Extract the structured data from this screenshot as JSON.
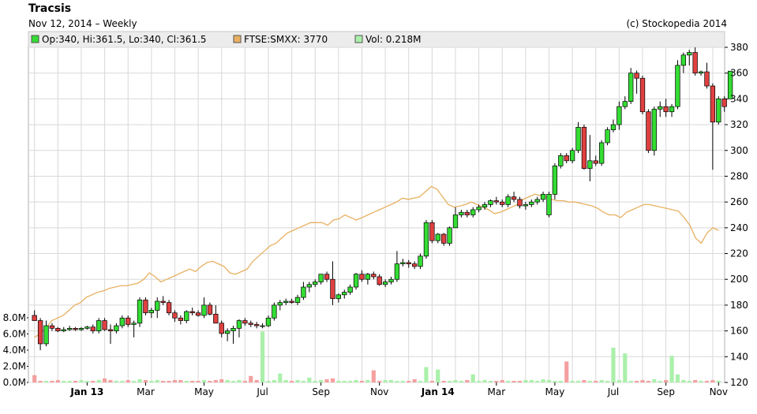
{
  "header": {
    "title": "Tracsis",
    "subtitle": "Nov 12, 2014 – Weekly",
    "copyright": "(c) Stockopedia 2014"
  },
  "legend": {
    "ohlc": "Op:340, Hi:361.5, Lo:340, Cl:361.5",
    "index": "FTSE:SMXX: 3770",
    "volume": "Vol: 0.218M"
  },
  "colors": {
    "up": "#33dd33",
    "down": "#e04040",
    "index_line": "#e8b060",
    "vol_up": "#aaf0aa",
    "vol_down": "#f4a0a0",
    "grid": "#d8d8d8",
    "legend_bg": "#ececec"
  },
  "chart_data": {
    "type": "candlestick",
    "price_axis": {
      "min": 120,
      "max": 380,
      "ticks": [
        120,
        140,
        160,
        180,
        200,
        220,
        240,
        260,
        280,
        300,
        320,
        340,
        360,
        380
      ]
    },
    "volume_axis": {
      "unit": "M",
      "min": 0,
      "max": 8,
      "ticks": [
        "0.0M",
        "2.0M",
        "4.0M",
        "6.0M",
        "8.0M"
      ],
      "tick_values": [
        0,
        2,
        4,
        6,
        8
      ]
    },
    "x_labels": [
      "Jan 13",
      "Mar",
      "May",
      "Jul",
      "Sep",
      "Nov",
      "Jan 14",
      "Mar",
      "May",
      "Jul",
      "Sep",
      "Nov"
    ],
    "x_label_weeks": [
      9,
      19,
      29,
      39,
      49,
      59,
      69,
      79,
      89,
      99,
      108,
      117
    ],
    "bold_labels": [
      "Jan 13",
      "Jan 14"
    ],
    "weeks": 118,
    "candles": [
      {
        "o": 172,
        "h": 176,
        "l": 168,
        "c": 168
      },
      {
        "o": 168,
        "h": 170,
        "l": 145,
        "c": 150
      },
      {
        "o": 150,
        "h": 168,
        "l": 148,
        "c": 164
      },
      {
        "o": 164,
        "h": 166,
        "l": 160,
        "c": 162
      },
      {
        "o": 162,
        "h": 163,
        "l": 159,
        "c": 160
      },
      {
        "o": 160,
        "h": 163,
        "l": 159,
        "c": 161
      },
      {
        "o": 161,
        "h": 164,
        "l": 160,
        "c": 162
      },
      {
        "o": 162,
        "h": 163,
        "l": 160,
        "c": 161
      },
      {
        "o": 161,
        "h": 163,
        "l": 160,
        "c": 162
      },
      {
        "o": 162,
        "h": 164,
        "l": 161,
        "c": 163
      },
      {
        "o": 163,
        "h": 165,
        "l": 158,
        "c": 160
      },
      {
        "o": 160,
        "h": 170,
        "l": 158,
        "c": 168
      },
      {
        "o": 168,
        "h": 170,
        "l": 160,
        "c": 161
      },
      {
        "o": 161,
        "h": 165,
        "l": 150,
        "c": 160
      },
      {
        "o": 160,
        "h": 166,
        "l": 158,
        "c": 164
      },
      {
        "o": 164,
        "h": 172,
        "l": 162,
        "c": 170
      },
      {
        "o": 170,
        "h": 172,
        "l": 163,
        "c": 165
      },
      {
        "o": 165,
        "h": 168,
        "l": 155,
        "c": 166
      },
      {
        "o": 166,
        "h": 186,
        "l": 163,
        "c": 184
      },
      {
        "o": 184,
        "h": 186,
        "l": 172,
        "c": 174
      },
      {
        "o": 174,
        "h": 178,
        "l": 170,
        "c": 176
      },
      {
        "o": 176,
        "h": 186,
        "l": 170,
        "c": 183
      },
      {
        "o": 183,
        "h": 187,
        "l": 180,
        "c": 182
      },
      {
        "o": 182,
        "h": 184,
        "l": 172,
        "c": 174
      },
      {
        "o": 174,
        "h": 176,
        "l": 167,
        "c": 170
      },
      {
        "o": 170,
        "h": 172,
        "l": 165,
        "c": 168
      },
      {
        "o": 168,
        "h": 176,
        "l": 166,
        "c": 175
      },
      {
        "o": 175,
        "h": 178,
        "l": 172,
        "c": 174
      },
      {
        "o": 174,
        "h": 176,
        "l": 171,
        "c": 172
      },
      {
        "o": 172,
        "h": 186,
        "l": 170,
        "c": 180
      },
      {
        "o": 180,
        "h": 182,
        "l": 172,
        "c": 173
      },
      {
        "o": 173,
        "h": 180,
        "l": 166,
        "c": 166
      },
      {
        "o": 166,
        "h": 168,
        "l": 155,
        "c": 158
      },
      {
        "o": 158,
        "h": 162,
        "l": 152,
        "c": 160
      },
      {
        "o": 160,
        "h": 164,
        "l": 150,
        "c": 162
      },
      {
        "o": 162,
        "h": 169,
        "l": 155,
        "c": 168
      },
      {
        "o": 168,
        "h": 170,
        "l": 164,
        "c": 166
      },
      {
        "o": 166,
        "h": 168,
        "l": 163,
        "c": 165
      },
      {
        "o": 165,
        "h": 167,
        "l": 162,
        "c": 164
      },
      {
        "o": 164,
        "h": 166,
        "l": 162,
        "c": 164
      },
      {
        "o": 164,
        "h": 172,
        "l": 163,
        "c": 170
      },
      {
        "o": 170,
        "h": 182,
        "l": 168,
        "c": 180
      },
      {
        "o": 180,
        "h": 184,
        "l": 176,
        "c": 182
      },
      {
        "o": 182,
        "h": 185,
        "l": 180,
        "c": 183
      },
      {
        "o": 183,
        "h": 185,
        "l": 181,
        "c": 182
      },
      {
        "o": 182,
        "h": 188,
        "l": 180,
        "c": 186
      },
      {
        "o": 186,
        "h": 198,
        "l": 184,
        "c": 194
      },
      {
        "o": 194,
        "h": 198,
        "l": 190,
        "c": 196
      },
      {
        "o": 196,
        "h": 200,
        "l": 194,
        "c": 198
      },
      {
        "o": 198,
        "h": 204,
        "l": 196,
        "c": 204
      },
      {
        "o": 204,
        "h": 206,
        "l": 198,
        "c": 200
      },
      {
        "o": 200,
        "h": 214,
        "l": 180,
        "c": 185
      },
      {
        "o": 185,
        "h": 189,
        "l": 182,
        "c": 188
      },
      {
        "o": 188,
        "h": 192,
        "l": 185,
        "c": 190
      },
      {
        "o": 190,
        "h": 196,
        "l": 188,
        "c": 194
      },
      {
        "o": 194,
        "h": 205,
        "l": 192,
        "c": 204
      },
      {
        "o": 204,
        "h": 207,
        "l": 198,
        "c": 200
      },
      {
        "o": 200,
        "h": 205,
        "l": 196,
        "c": 204
      },
      {
        "o": 204,
        "h": 206,
        "l": 200,
        "c": 202
      },
      {
        "o": 202,
        "h": 204,
        "l": 195,
        "c": 196
      },
      {
        "o": 196,
        "h": 200,
        "l": 194,
        "c": 198
      },
      {
        "o": 198,
        "h": 202,
        "l": 196,
        "c": 200
      },
      {
        "o": 200,
        "h": 222,
        "l": 198,
        "c": 212
      },
      {
        "o": 212,
        "h": 216,
        "l": 210,
        "c": 213
      },
      {
        "o": 213,
        "h": 215,
        "l": 209,
        "c": 212
      },
      {
        "o": 212,
        "h": 214,
        "l": 208,
        "c": 210
      },
      {
        "o": 210,
        "h": 220,
        "l": 208,
        "c": 218
      },
      {
        "o": 218,
        "h": 246,
        "l": 216,
        "c": 244
      },
      {
        "o": 244,
        "h": 246,
        "l": 228,
        "c": 230
      },
      {
        "o": 230,
        "h": 236,
        "l": 228,
        "c": 235
      },
      {
        "o": 235,
        "h": 236,
        "l": 226,
        "c": 228
      },
      {
        "o": 228,
        "h": 241,
        "l": 226,
        "c": 240
      },
      {
        "o": 240,
        "h": 256,
        "l": 240,
        "c": 250
      },
      {
        "o": 250,
        "h": 254,
        "l": 248,
        "c": 252
      },
      {
        "o": 252,
        "h": 254,
        "l": 248,
        "c": 250
      },
      {
        "o": 250,
        "h": 256,
        "l": 248,
        "c": 254
      },
      {
        "o": 254,
        "h": 258,
        "l": 252,
        "c": 256
      },
      {
        "o": 256,
        "h": 260,
        "l": 254,
        "c": 258
      },
      {
        "o": 258,
        "h": 262,
        "l": 256,
        "c": 261
      },
      {
        "o": 261,
        "h": 264,
        "l": 258,
        "c": 260
      },
      {
        "o": 260,
        "h": 262,
        "l": 256,
        "c": 258
      },
      {
        "o": 258,
        "h": 266,
        "l": 256,
        "c": 264
      },
      {
        "o": 264,
        "h": 268,
        "l": 260,
        "c": 262
      },
      {
        "o": 262,
        "h": 264,
        "l": 255,
        "c": 257
      },
      {
        "o": 257,
        "h": 260,
        "l": 254,
        "c": 258
      },
      {
        "o": 258,
        "h": 262,
        "l": 256,
        "c": 260
      },
      {
        "o": 260,
        "h": 264,
        "l": 258,
        "c": 262
      },
      {
        "o": 262,
        "h": 268,
        "l": 260,
        "c": 266
      },
      {
        "o": 250,
        "h": 268,
        "l": 248,
        "c": 266
      },
      {
        "o": 266,
        "h": 290,
        "l": 262,
        "c": 288
      },
      {
        "o": 288,
        "h": 298,
        "l": 286,
        "c": 296
      },
      {
        "o": 296,
        "h": 298,
        "l": 290,
        "c": 292
      },
      {
        "o": 292,
        "h": 302,
        "l": 290,
        "c": 300
      },
      {
        "o": 300,
        "h": 322,
        "l": 298,
        "c": 318
      },
      {
        "o": 318,
        "h": 320,
        "l": 285,
        "c": 286
      },
      {
        "o": 286,
        "h": 312,
        "l": 276,
        "c": 292
      },
      {
        "o": 292,
        "h": 296,
        "l": 288,
        "c": 290
      },
      {
        "o": 290,
        "h": 308,
        "l": 288,
        "c": 306
      },
      {
        "o": 306,
        "h": 318,
        "l": 304,
        "c": 316
      },
      {
        "o": 316,
        "h": 324,
        "l": 314,
        "c": 320
      },
      {
        "o": 320,
        "h": 338,
        "l": 316,
        "c": 334
      },
      {
        "o": 334,
        "h": 342,
        "l": 332,
        "c": 338
      },
      {
        "o": 338,
        "h": 364,
        "l": 336,
        "c": 360
      },
      {
        "o": 360,
        "h": 362,
        "l": 344,
        "c": 356
      },
      {
        "o": 356,
        "h": 358,
        "l": 328,
        "c": 330
      },
      {
        "o": 330,
        "h": 332,
        "l": 298,
        "c": 300
      },
      {
        "o": 300,
        "h": 334,
        "l": 296,
        "c": 332
      },
      {
        "o": 332,
        "h": 338,
        "l": 326,
        "c": 334
      },
      {
        "o": 334,
        "h": 340,
        "l": 326,
        "c": 330
      },
      {
        "o": 330,
        "h": 336,
        "l": 326,
        "c": 334
      },
      {
        "o": 334,
        "h": 370,
        "l": 332,
        "c": 366
      },
      {
        "o": 366,
        "h": 376,
        "l": 360,
        "c": 374
      },
      {
        "o": 374,
        "h": 378,
        "l": 366,
        "c": 376
      },
      {
        "o": 376,
        "h": 380,
        "l": 358,
        "c": 360
      },
      {
        "o": 360,
        "h": 362,
        "l": 358,
        "c": 361
      },
      {
        "o": 361,
        "h": 368,
        "l": 348,
        "c": 350
      },
      {
        "o": 350,
        "h": 352,
        "l": 285,
        "c": 322
      },
      {
        "o": 322,
        "h": 342,
        "l": 320,
        "c": 340
      },
      {
        "o": 340,
        "h": 342,
        "l": 330,
        "c": 334
      },
      {
        "o": 340,
        "h": 361.5,
        "l": 340,
        "c": 361.5
      }
    ],
    "volume": [
      0.3,
      0.2,
      0.2,
      0.2,
      0.3,
      0.2,
      0.2,
      0.2,
      0.3,
      0.2,
      0.2,
      0.3,
      0.4,
      0.3,
      0.2,
      0.2,
      0.3,
      0.2,
      0.4,
      0.3,
      0.2,
      0.3,
      0.2,
      0.2,
      0.3,
      0.3,
      0.2,
      0.2,
      0.2,
      0.3,
      0.2,
      0.3,
      0.4,
      0.3,
      0.2,
      0.3,
      0.2,
      0.2,
      0.3,
      0.2,
      0.2,
      0.3,
      0.2,
      0.3,
      0.2,
      0.3,
      0.2,
      0.3,
      0.2,
      0.3,
      0.4,
      0.3,
      0.2,
      0.2,
      0.2,
      0.3,
      0.2,
      0.3,
      0.2,
      0.2,
      0.3,
      0.3,
      0.2,
      0.2,
      0.2,
      0.4,
      0.2,
      0.3,
      0.2,
      0.3,
      0.2,
      0.2,
      0.3,
      0.2,
      0.3,
      0.2,
      0.2,
      0.3,
      0.2,
      0.2,
      0.3,
      0.2,
      0.2,
      0.2,
      0.2,
      0.3,
      0.2,
      0.4,
      0.3,
      0.2,
      0.2,
      0.3,
      0.2,
      0.2,
      0.3,
      0.2,
      0.2,
      0.3,
      0.2,
      0.2,
      0.3,
      0.2,
      0.2,
      0.2,
      0.3,
      0.2,
      0.2,
      0.2,
      0.3,
      0.2,
      0.2,
      0.3,
      0.2,
      0.3,
      0.2,
      0.2,
      0.3,
      0.218
    ],
    "volume_spikes": {
      "0": 0.9,
      "12": 0.5,
      "37": 0.8,
      "42": 1.1,
      "47": 0.6,
      "51": 0.5,
      "58": 1.5,
      "69": 1.6,
      "75": 1.0,
      "84": 0.3,
      "91": 0.4,
      "99": 0.6,
      "101": 0.9,
      "106": 0.4,
      "110": 1.0,
      "117": 0.218
    },
    "volume_big": {
      "39": 6.3,
      "67": 1.9,
      "91": 2.6,
      "99": 4.3,
      "101": 3.6,
      "109": 3.3
    },
    "index_line": [
      155,
      158,
      162,
      168,
      170,
      172,
      176,
      180,
      182,
      186,
      188,
      190,
      191,
      193,
      194,
      195,
      195,
      196,
      197,
      200,
      205,
      202,
      198,
      200,
      202,
      204,
      206,
      208,
      206,
      210,
      213,
      214,
      212,
      210,
      205,
      204,
      206,
      208,
      214,
      218,
      222,
      226,
      228,
      232,
      236,
      238,
      240,
      242,
      244,
      244,
      244,
      242,
      246,
      247,
      250,
      248,
      246,
      248,
      250,
      252,
      254,
      256,
      258,
      260,
      263,
      262,
      263,
      264,
      268,
      272,
      270,
      264,
      258,
      256,
      257,
      258,
      260,
      258,
      256,
      254,
      251,
      252,
      254,
      256,
      258,
      262,
      264,
      266,
      265,
      264,
      262,
      261,
      261,
      260,
      260,
      259,
      258,
      257,
      255,
      252,
      250,
      250,
      248,
      252,
      254,
      256,
      258,
      258,
      257,
      256,
      255,
      254,
      253,
      248,
      242,
      232,
      228,
      236,
      240,
      238
    ]
  }
}
